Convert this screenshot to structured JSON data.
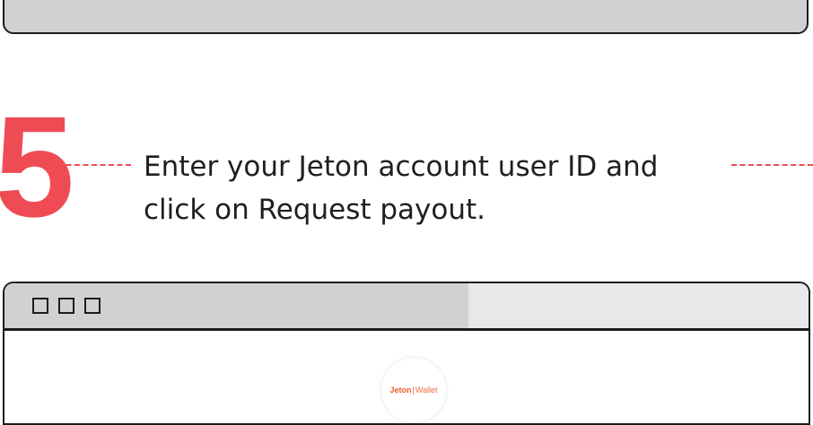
{
  "step": {
    "number": "5",
    "instruction": "Enter your Jeton account user ID and click on Request payout."
  },
  "browser": {
    "logo": {
      "brand": "Jeton",
      "separator": "|",
      "product": "Wallet"
    }
  },
  "colors": {
    "accent": "#ef4b55",
    "brand": "#ef5a24",
    "frame": "#1c1c1c",
    "chrome_gray": "#d0d1d3"
  }
}
